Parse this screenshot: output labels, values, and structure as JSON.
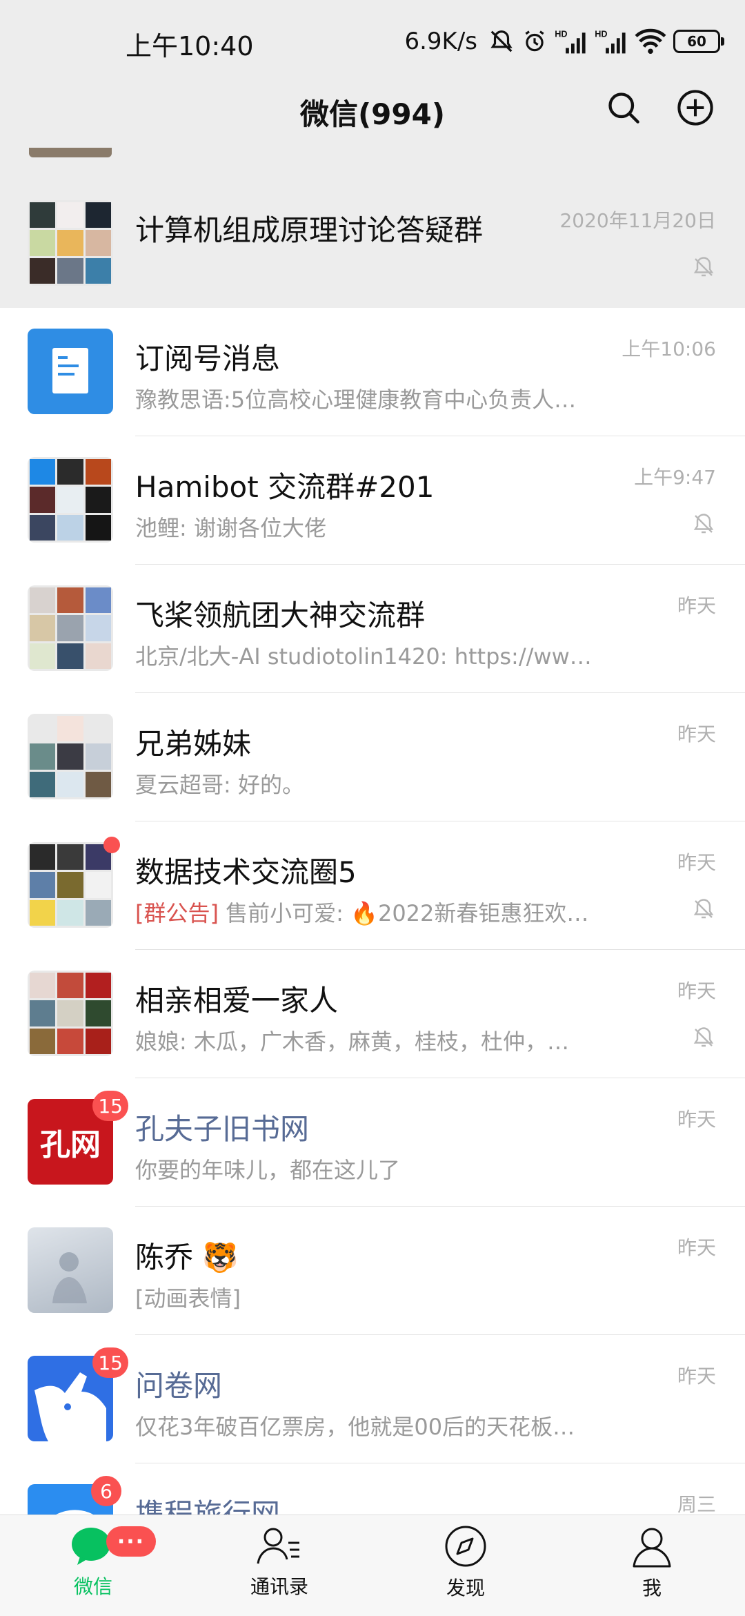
{
  "status": {
    "time": "上午10:40",
    "speed": "6.9K/s",
    "battery": "60"
  },
  "header": {
    "title": "微信(994)"
  },
  "chats": [
    {
      "name": "计算机组成原理讨论答疑群",
      "preview": "",
      "time": "2020年11月20日",
      "muted": true
    },
    {
      "name": "订阅号消息",
      "preview": "豫教思语:5位高校心理健康教育中心负责人…",
      "time": "上午10:06",
      "muted": false
    },
    {
      "name": "Hamibot 交流群#201",
      "preview": "池鲤: 谢谢各位大佬",
      "time": "上午9:47",
      "muted": true
    },
    {
      "name": "飞桨领航团大神交流群",
      "preview": "北京/北大-AI studiotolin1420: https://ww…",
      "time": "昨天",
      "muted": false
    },
    {
      "name": "兄弟姊妹",
      "preview": "夏云超哥: 好的。",
      "time": "昨天",
      "muted": false
    },
    {
      "name": "数据技术交流圈5",
      "tag": "[群公告]",
      "preview": " 售前小可爱: 🔥2022新春钜惠狂欢…",
      "time": "昨天",
      "muted": true
    },
    {
      "name": "相亲相爱一家人",
      "preview": "娘娘: 木瓜，广木香，麻黄，桂枝，杜仲，…",
      "time": "昨天",
      "muted": true
    },
    {
      "name": "孔夫子旧书网",
      "preview": "你要的年味儿，都在这儿了",
      "time": "昨天",
      "badge": "15",
      "logo": "孔网"
    },
    {
      "name": "陈乔 🐯",
      "preview": "[动画表情]",
      "time": "昨天"
    },
    {
      "name": "问卷网",
      "preview": "仅花3年破百亿票房，他就是00后的天花板…",
      "time": "昨天",
      "badge": "15"
    },
    {
      "name": "携程旅行网",
      "preview": "",
      "time": "周三",
      "badge": "6"
    }
  ],
  "tabs": [
    {
      "label": "微信",
      "badge": "···"
    },
    {
      "label": "通讯录"
    },
    {
      "label": "发现"
    },
    {
      "label": "我"
    }
  ],
  "colors": {
    "accent": "#07c160",
    "badge": "#fa5151",
    "official_name": "#576b95"
  },
  "icons": [
    "search-icon",
    "add-circle-icon",
    "mute-bell-icon",
    "chat-bubble-icon",
    "contacts-icon",
    "compass-icon",
    "person-icon"
  ]
}
